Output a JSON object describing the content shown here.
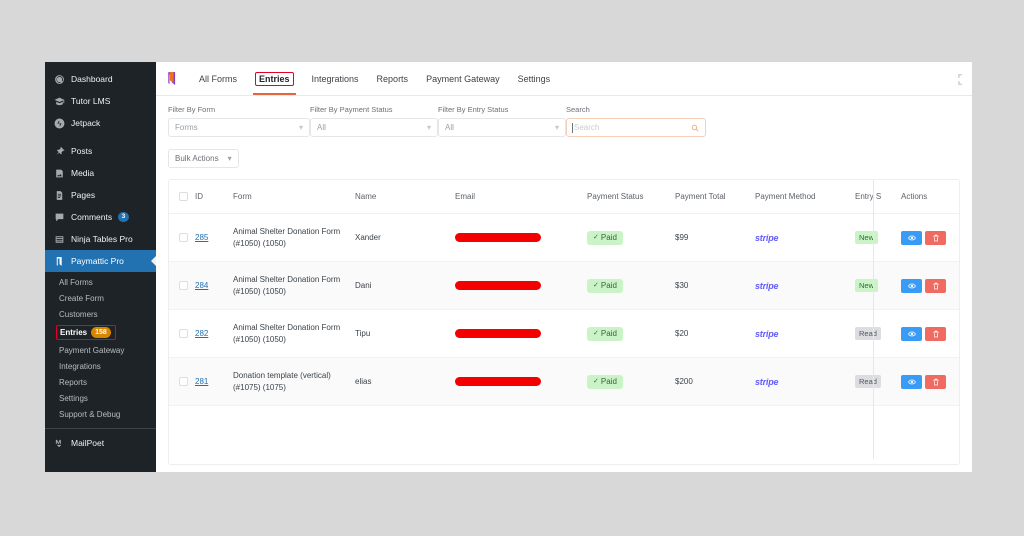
{
  "sidebar": {
    "items": [
      {
        "label": "Dashboard",
        "icon": "gauge-icon"
      },
      {
        "label": "Tutor LMS",
        "icon": "graduation-cap-icon"
      },
      {
        "label": "Jetpack",
        "icon": "jetpack-icon"
      },
      {
        "label": "Posts",
        "icon": "pin-icon"
      },
      {
        "label": "Media",
        "icon": "media-icon"
      },
      {
        "label": "Pages",
        "icon": "page-icon"
      },
      {
        "label": "Comments",
        "icon": "comment-icon",
        "badge": "3"
      },
      {
        "label": "Ninja Tables Pro",
        "icon": "table-icon"
      },
      {
        "label": "Paymattic Pro",
        "icon": "paymattic-icon",
        "current": true
      }
    ],
    "submenu": [
      {
        "label": "All Forms"
      },
      {
        "label": "Create Form"
      },
      {
        "label": "Customers"
      },
      {
        "label": "Entries",
        "count": "158",
        "active": true,
        "highlighted": true
      },
      {
        "label": "Payment Gateway"
      },
      {
        "label": "Integrations"
      },
      {
        "label": "Reports"
      },
      {
        "label": "Settings"
      },
      {
        "label": "Support & Debug"
      }
    ],
    "footer_item": {
      "label": "MailPoet",
      "icon": "mailpoet-icon"
    }
  },
  "topbar": {
    "logo_icon": "paymattic-logo-icon",
    "tabs": [
      {
        "label": "All Forms",
        "active": false
      },
      {
        "label": "Entries",
        "active": true
      },
      {
        "label": "Integrations",
        "active": false
      },
      {
        "label": "Reports",
        "active": false
      },
      {
        "label": "Payment Gateway",
        "active": false
      },
      {
        "label": "Settings",
        "active": false
      }
    ]
  },
  "filters": {
    "form": {
      "label": "Filter By Form",
      "value": "Forms"
    },
    "payment_status": {
      "label": "Filter By Payment Status",
      "value": "All"
    },
    "entry_status": {
      "label": "Filter By Entry Status",
      "value": "All"
    },
    "search": {
      "label": "Search",
      "placeholder": "Search",
      "value": ""
    }
  },
  "bulk_actions": {
    "label": "Bulk Actions"
  },
  "table": {
    "columns": [
      "ID",
      "Form",
      "Name",
      "Email",
      "Payment Status",
      "Payment Total",
      "Payment Method",
      "Entry S",
      "Actions"
    ],
    "rows": [
      {
        "id": "285",
        "form": "Animal Shelter Donation Form (#1050) (1050)",
        "name": "Xander",
        "email": "",
        "payment_status": "Paid",
        "payment_total": "$99",
        "payment_method": "stripe",
        "entry_status": "New",
        "entry_status_type": "new"
      },
      {
        "id": "284",
        "form": "Animal Shelter Donation Form (#1050) (1050)",
        "name": "Dani",
        "email": "",
        "payment_status": "Paid",
        "payment_total": "$30",
        "payment_method": "stripe",
        "entry_status": "New",
        "entry_status_type": "new"
      },
      {
        "id": "282",
        "form": "Animal Shelter Donation Form (#1050) (1050)",
        "name": "Tipu",
        "email": "",
        "payment_status": "Paid",
        "payment_total": "$20",
        "payment_method": "stripe",
        "entry_status": "Read",
        "entry_status_type": "read"
      },
      {
        "id": "281",
        "form": "Donation template (vertical) (#1075) (1075)",
        "name": "elias",
        "email": "",
        "payment_status": "Paid",
        "payment_total": "$200",
        "payment_method": "stripe",
        "entry_status": "Read",
        "entry_status_type": "read"
      }
    ],
    "row_actions": {
      "view": "view-entry",
      "delete": "delete-entry"
    }
  },
  "colors": {
    "accent_orange": "#e3663e",
    "annotation_red": "#e4002b",
    "wp_admin_blue": "#2271b1",
    "stripe_purple": "#635bff",
    "paid_green_bg": "#caf3c8",
    "count_badge_orange": "#d98500",
    "redaction_red": "#f40000"
  }
}
